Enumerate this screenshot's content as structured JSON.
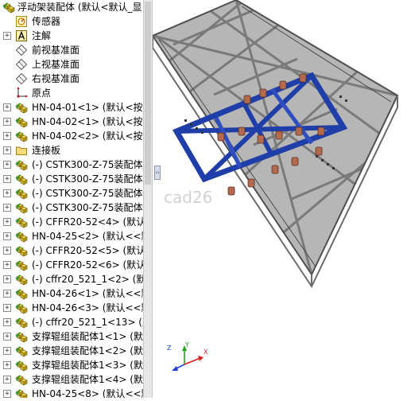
{
  "feature_tree": {
    "root": {
      "label": "浮动架装配体 (默认<默认_显",
      "icon": "assembly-icon"
    },
    "items": [
      {
        "label": "传感器",
        "icon": "sensor-icon",
        "expander": false
      },
      {
        "label": "注解",
        "icon": "annotation-icon",
        "expander": true
      },
      {
        "label": "前视基准面",
        "icon": "plane-icon",
        "expander": false
      },
      {
        "label": "上视基准面",
        "icon": "plane-icon",
        "expander": false
      },
      {
        "label": "右视基准面",
        "icon": "plane-icon",
        "expander": false
      },
      {
        "label": "原点",
        "icon": "origin-icon",
        "expander": false
      },
      {
        "label": "HN-04-01<1> (默认<按",
        "icon": "subassembly-icon",
        "expander": true
      },
      {
        "label": "HN-04-02<1> (默认<按",
        "icon": "subassembly-icon",
        "expander": true
      },
      {
        "label": "HN-04-02<2> (默认<按",
        "icon": "subassembly-icon",
        "expander": true
      },
      {
        "label": "连接板",
        "icon": "folder-icon",
        "expander": true
      },
      {
        "label": "(-) CSTK300-Z-75装配体",
        "icon": "subassembly-icon",
        "expander": true
      },
      {
        "label": "(-) CSTK300-Z-75装配体",
        "icon": "subassembly-icon",
        "expander": true
      },
      {
        "label": "(-) CSTK300-Z-75装配体",
        "icon": "subassembly-icon",
        "expander": true
      },
      {
        "label": "(-) CSTK300-Z-75装配体",
        "icon": "subassembly-icon",
        "expander": true
      },
      {
        "label": "(-) CFFR20-52<4> (默认",
        "icon": "subassembly-icon",
        "expander": true
      },
      {
        "label": "HN-04-25<2> (默认<<默",
        "icon": "subassembly-icon",
        "expander": true
      },
      {
        "label": "(-) CFFR20-52<5> (默认",
        "icon": "subassembly-icon",
        "expander": true
      },
      {
        "label": "(-) CFFR20-52<6> (默认",
        "icon": "subassembly-icon",
        "expander": true
      },
      {
        "label": "(-) cffr20_521_1<2> (默认",
        "icon": "subassembly-icon",
        "expander": true
      },
      {
        "label": "HN-04-26<1> (默认<<默",
        "icon": "subassembly-icon",
        "expander": true
      },
      {
        "label": "HN-04-26<3> (默认<<默",
        "icon": "subassembly-icon",
        "expander": true
      },
      {
        "label": "(-) cffr20_521_1<13> (默",
        "icon": "subassembly-icon",
        "expander": true
      },
      {
        "label": "支撑辊组装配体1<1> (默认",
        "icon": "subassembly-icon",
        "expander": true
      },
      {
        "label": "支撑辊组装配体1<2> (默认",
        "icon": "subassembly-icon",
        "expander": true
      },
      {
        "label": "支撑辊组装配体1<3> (默认",
        "icon": "subassembly-icon",
        "expander": true
      },
      {
        "label": "支撑辊组装配体1<4> (默认",
        "icon": "subassembly-icon",
        "expander": true
      },
      {
        "label": "HN-04-25<8> (默认<<默",
        "icon": "subassembly-icon",
        "expander": true
      }
    ]
  },
  "viewport": {
    "watermark": "cad26",
    "model": "floating-frame-assembly-isometric",
    "triad_labels": {
      "x": "X",
      "y": "Y",
      "z": "Z"
    }
  },
  "colors": {
    "frame_gray": "#8a8a8a",
    "plate_gray": "#bfbfbf",
    "blue_beam": "#1f3ea8",
    "roller_copper": "#b36a4e",
    "axis_x": "#d62020",
    "axis_y": "#1fa31f",
    "axis_z": "#2040d0"
  }
}
